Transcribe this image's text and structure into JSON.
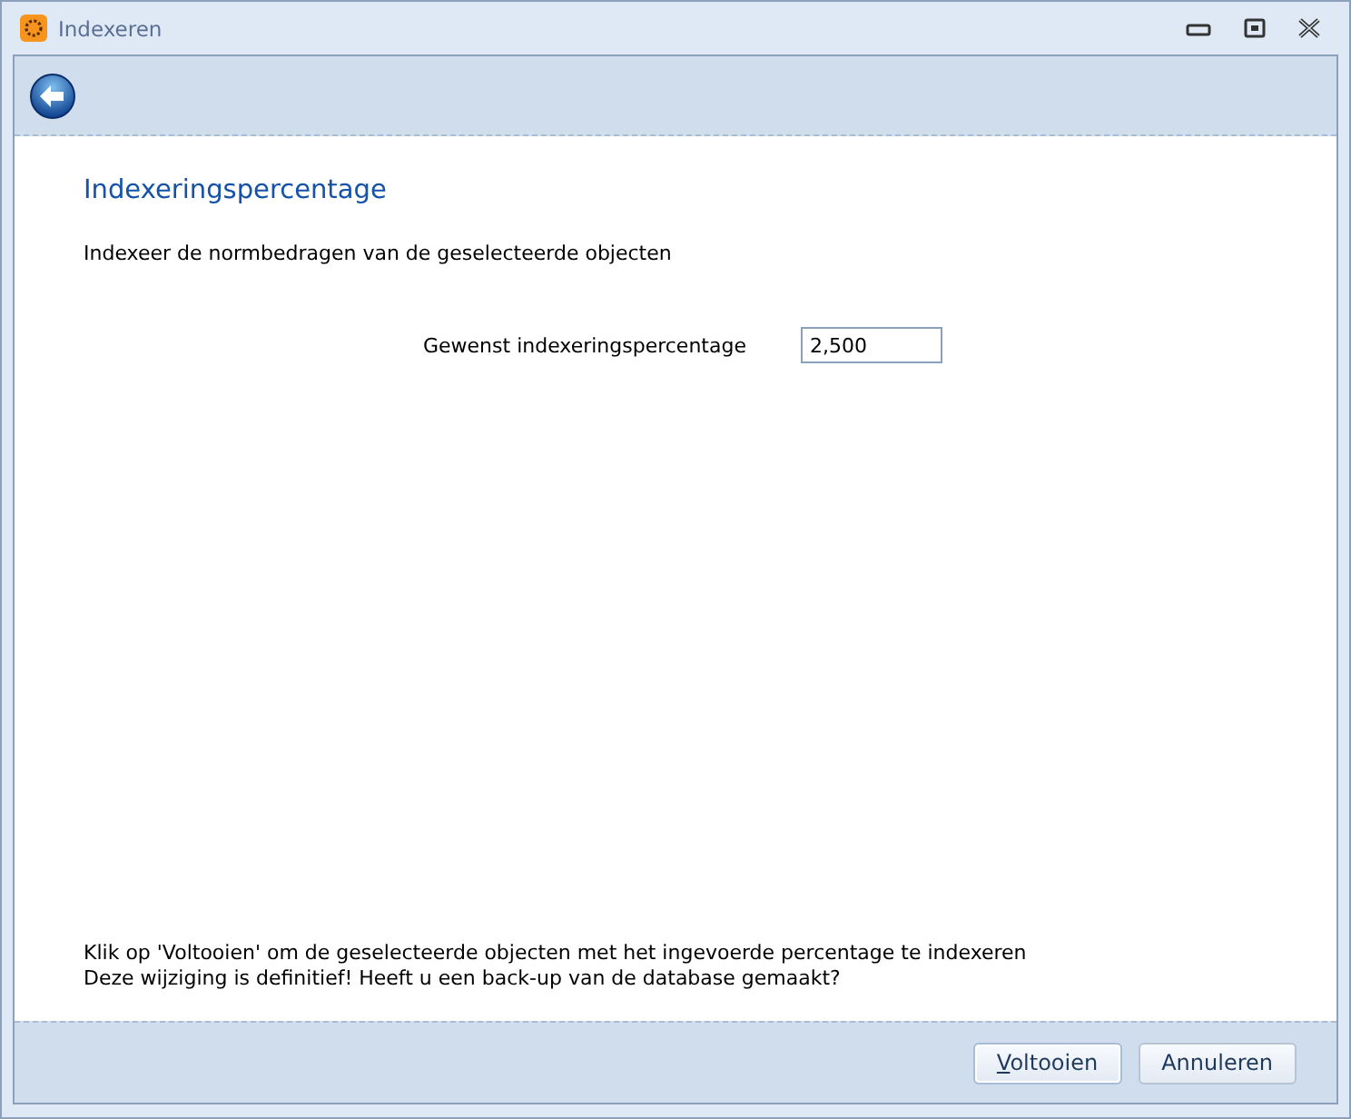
{
  "window": {
    "title": "Indexeren"
  },
  "page": {
    "heading": "Indexeringspercentage",
    "description": "Indexeer de normbedragen van de geselecteerde objecten"
  },
  "field": {
    "label": "Gewenst indexeringspercentage",
    "value": "2,500"
  },
  "footer_notes": [
    "Klik op 'Voltooien' om de geselecteerde objecten met het ingevoerde percentage te indexeren",
    "Deze wijziging is definitief! Heeft u een back-up van de database gemaakt?"
  ],
  "buttons": [
    {
      "label": "Voltooien",
      "mnemonic": true,
      "default": true
    },
    {
      "label": "Annuleren",
      "mnemonic": false,
      "default": false
    }
  ]
}
